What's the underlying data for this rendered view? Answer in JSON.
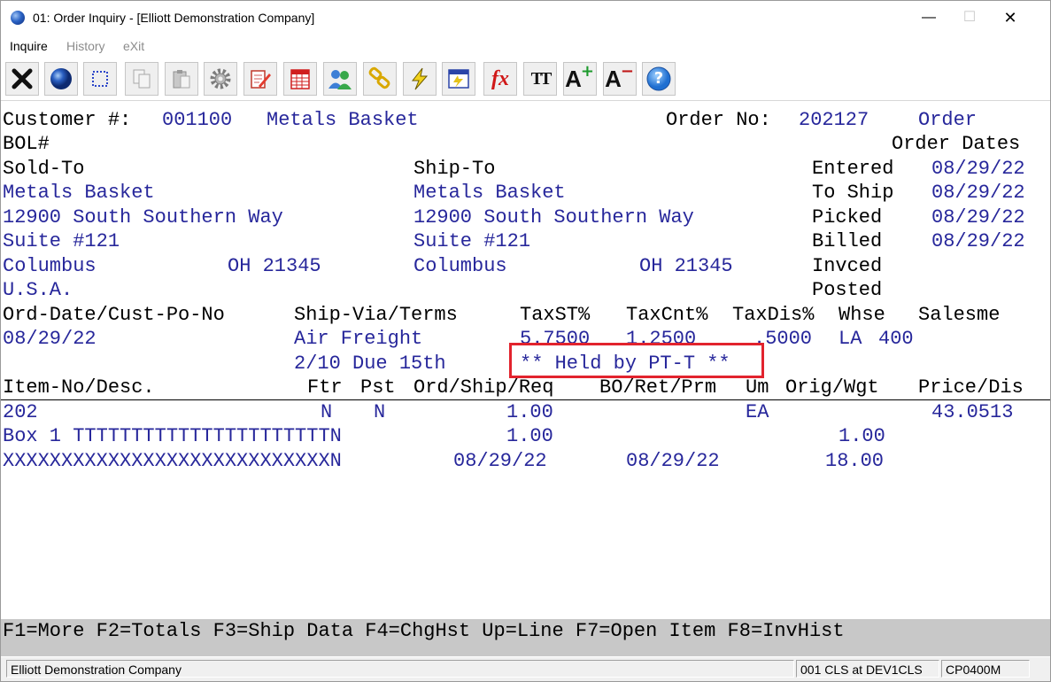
{
  "window": {
    "title": "01: Order Inquiry - [Elliott Demonstration Company]",
    "minimize_glyph": "—",
    "maximize_glyph": "☐",
    "close_glyph": "✕"
  },
  "menu": [
    {
      "label": "Inquire",
      "enabled": true
    },
    {
      "label": "History",
      "enabled": false
    },
    {
      "label": "eXit",
      "enabled": false
    }
  ],
  "toolbar_icons": [
    "close-x-icon",
    "globe-icon",
    "select-icon",
    "copy-icon",
    "paste-icon",
    "settings-gear-icon",
    "edit-note-icon",
    "calendar-icon",
    "users-icon",
    "link-icon",
    "lightning-icon",
    "calculator-icon",
    "function-fx-icon",
    "font-icon",
    "font-increase-icon",
    "font-decrease-icon",
    "help-icon"
  ],
  "toolbar_glyphs": {
    "fx": "fx",
    "font": "TT",
    "font_big": "A",
    "plus": "+",
    "minus": "−",
    "help": "?"
  },
  "header": {
    "customer_label": "Customer #:",
    "customer_number": "001100",
    "customer_name": "Metals Basket",
    "order_no_label": "Order No:",
    "order_no": "202127",
    "order_word": "Order",
    "bol_label": "BOL#",
    "order_dates_label": "Order Dates"
  },
  "sold_to": {
    "label": "Sold-To",
    "name": "Metals Basket",
    "address1": "12900 South Southern Way",
    "address2": "Suite #121",
    "city": "Columbus",
    "state_zip": "OH 21345",
    "country": "U.S.A."
  },
  "ship_to": {
    "label": "Ship-To",
    "name": "Metals Basket",
    "address1": "12900 South Southern Way",
    "address2": "Suite #121",
    "city": "Columbus",
    "state_zip": "OH 21345"
  },
  "dates": {
    "entered_label": "Entered",
    "entered": "08/29/22",
    "to_ship_label": "To Ship",
    "to_ship": "08/29/22",
    "picked_label": "Picked",
    "picked": "08/29/22",
    "billed_label": "Billed",
    "billed": "08/29/22",
    "invced_label": "Invced",
    "posted_label": "Posted"
  },
  "info": {
    "ord_date_label": "Ord-Date/Cust-Po-No",
    "ship_via_label": "Ship-Via/Terms",
    "taxst_label": "TaxST%",
    "taxcnt_label": "TaxCnt%",
    "taxdis_label": "TaxDis%",
    "whse_label": "Whse",
    "salesman_label": "Salesme",
    "ord_date": "08/29/22",
    "ship_via": "Air Freight",
    "taxst": "5.7500",
    "taxcnt": "1.2500",
    "taxdis": ".5000",
    "whse": "LA",
    "salesman": "400",
    "terms": "2/10 Due 15th",
    "held_status": "** Held by PT-T **"
  },
  "lines": {
    "headers": {
      "item": "Item-No/Desc.",
      "ftr": "Ftr",
      "pst": "Pst",
      "ord_ship_req": "Ord/Ship/Req",
      "bo_ret_prm": "BO/Ret/Prm",
      "um": "Um",
      "orig_wgt": "Orig/Wgt",
      "price_dis": "Price/Dis"
    },
    "item_no": "202",
    "ftr": "N",
    "pst": "N",
    "ordered": "1.00",
    "um": "EA",
    "price": "43.0513",
    "desc1": "Box 1 TTTTTTTTTTTTTTTTTTTTTTN",
    "shipped": "1.00",
    "orig": "1.00",
    "desc2": "XXXXXXXXXXXXXXXXXXXXXXXXXXXXN",
    "req_date": "08/29/22",
    "prm_date": "08/29/22",
    "weight": "18.00"
  },
  "function_keys": "F1=More F2=Totals F3=Ship Data F4=ChgHst Up=Line F7=Open Item F8=InvHist",
  "status_bar": {
    "company": "Elliott Demonstration Company",
    "session": "001 CLS at DEV1CLS",
    "program": "CP0400M"
  }
}
